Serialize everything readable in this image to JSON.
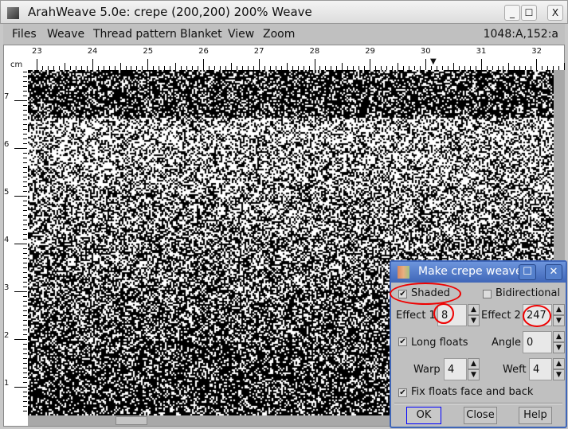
{
  "window": {
    "title": "ArahWeave 5.0e: crepe (200,200) 200% Weave",
    "minimize": "_",
    "maximize": "☐",
    "close": "X"
  },
  "menu": [
    "Files",
    "Weave",
    "Thread pattern",
    "Blanket",
    "View",
    "Zoom"
  ],
  "status": "1048:A,152:a",
  "ruler": {
    "unit": "cm",
    "top": [
      "23",
      "24",
      "25",
      "26",
      "27",
      "28",
      "29",
      "30",
      "31",
      "32"
    ],
    "left": [
      "7",
      "6",
      "5",
      "4",
      "3",
      "2",
      "1"
    ]
  },
  "dialog": {
    "title": "Make crepe weave",
    "shaded": {
      "label": "Shaded",
      "checked": true
    },
    "bidirectional": {
      "label": "Bidirectional",
      "checked": false
    },
    "effect1": {
      "label": "Effect 1",
      "value": "8"
    },
    "effect2": {
      "label": "Effect 2",
      "value": "247"
    },
    "long_floats": {
      "label": "Long floats",
      "checked": true
    },
    "angle": {
      "label": "Angle",
      "value": "0"
    },
    "warp": {
      "label": "Warp",
      "value": "4"
    },
    "weft": {
      "label": "Weft",
      "value": "4"
    },
    "fix_floats": {
      "label": "Fix floats face and back",
      "checked": true
    },
    "ok": "OK",
    "close": "Close",
    "help": "Help",
    "annotation_color": "#e00000"
  }
}
